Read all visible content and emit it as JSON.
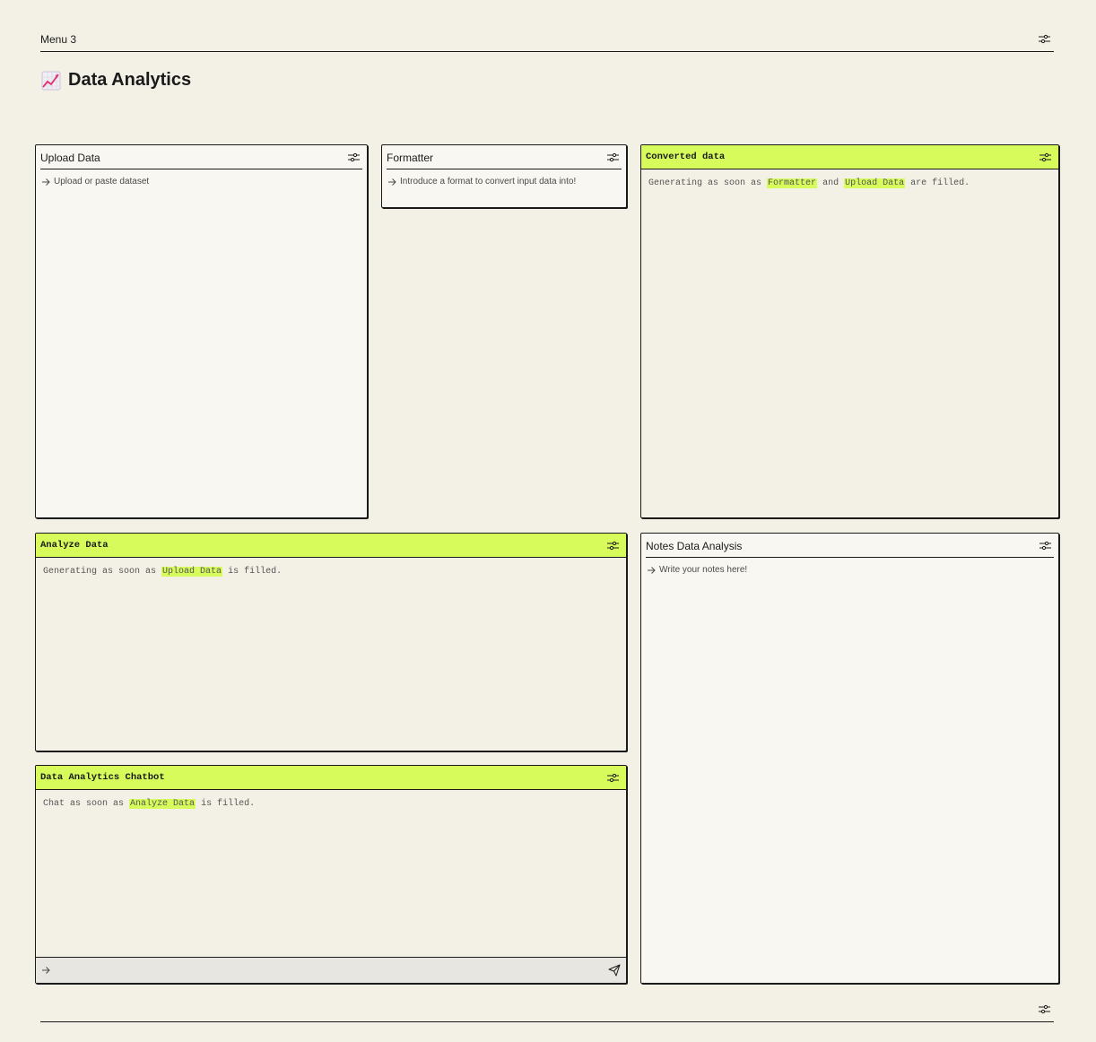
{
  "topbar": {
    "menu_label": "Menu 3",
    "settings_icon": "sliders-icon"
  },
  "page": {
    "title": "Data Analytics",
    "title_icon": "chart-increasing-icon"
  },
  "panels": {
    "upload": {
      "title": "Upload Data",
      "placeholder": "Upload or paste dataset"
    },
    "formatter": {
      "title": "Formatter",
      "placeholder": "Introduce a format to convert input data into!"
    },
    "converted": {
      "title": "Converted data",
      "text_prefix": "Generating as soon as",
      "ref1": "Formatter",
      "joiner": "and",
      "ref2": "Upload Data",
      "text_suffix": "are filled."
    },
    "analyze": {
      "title": "Analyze Data",
      "text_prefix": "Generating as soon as",
      "ref1": "Upload Data",
      "text_suffix": "is filled."
    },
    "notes": {
      "title": "Notes Data Analysis",
      "placeholder": "Write your notes here!"
    },
    "chatbot": {
      "title": "Data Analytics Chatbot",
      "text_prefix": "Chat as soon as",
      "ref1": "Analyze Data",
      "text_suffix": "is filled.",
      "send_icon": "send-icon"
    }
  },
  "colors": {
    "background": "#f3f0e5",
    "panel_bg": "#f9f7f1",
    "accent": "#d6fb5a",
    "border": "#1a1a1a",
    "chat_input_bg": "#e8e6e1"
  }
}
